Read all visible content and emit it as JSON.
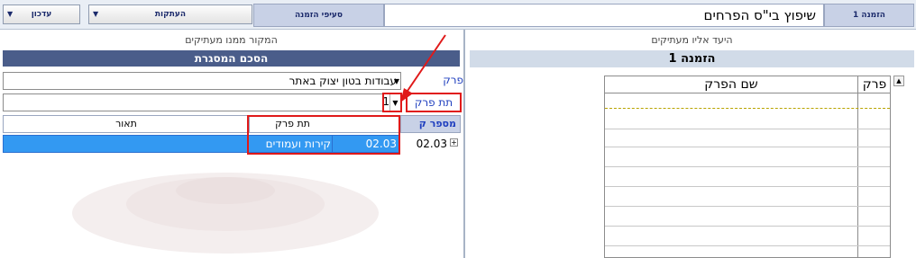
{
  "toolbar": {
    "update_label": "עדכון",
    "copies_label": "העתקות",
    "sections_label": "סעיפי הזמנה",
    "title": "שיפוץ בי\"ס הפרחים",
    "order_tab": "הזמנה 1"
  },
  "left_panel": {
    "caption": "המקור ממנו מעתיקים",
    "band": "הסכם המסגרת",
    "chapter_label": "פרק",
    "chapter_value": "עבודות בטון יצוק באתר",
    "subchapter_label": "תת פרק",
    "subchapter_value": "1",
    "columns": [
      "מספר ק",
      "תת פרק",
      "תאור"
    ],
    "row": {
      "number": "02.03",
      "sub": "02.03",
      "desc": "קירות ועמודים"
    }
  },
  "right_panel": {
    "caption": "היעד אליו מעתיקים",
    "band": "הזמנה 1",
    "columns": [
      "פרק",
      "שם הפרק"
    ]
  },
  "colors": {
    "accent": "#4a5d8a",
    "selection": "#3399f2",
    "highlight": "#e01919"
  },
  "icons": [
    "dropdown-caret-icon",
    "expand-icon",
    "arrow-annotation-icon"
  ]
}
